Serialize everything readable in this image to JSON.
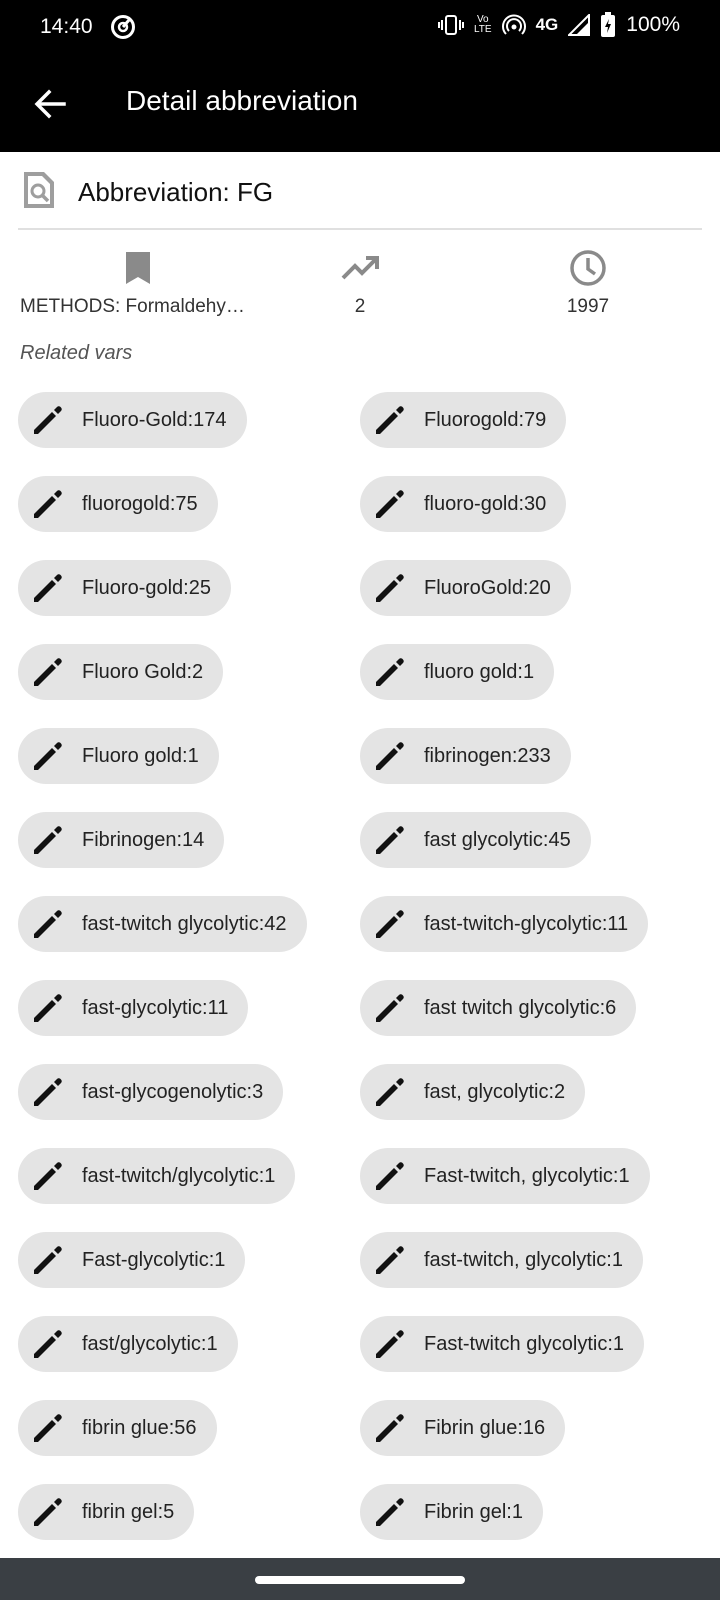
{
  "status_bar": {
    "time": "14:40",
    "volte_top": "Vo",
    "volte_bottom": "LTE",
    "network": "4G",
    "battery": "100%"
  },
  "app_bar": {
    "title": "Detail abbreviation"
  },
  "header": {
    "abbreviation": "Abbreviation: FG"
  },
  "stats": {
    "category": "METHODS: Formaldehyde-...",
    "count": "2",
    "year": "1997"
  },
  "related_label": "Related vars",
  "chips": [
    "Fluoro-Gold:174",
    "Fluorogold:79",
    "fluorogold:75",
    "fluoro-gold:30",
    "Fluoro-gold:25",
    "FluoroGold:20",
    "Fluoro Gold:2",
    "fluoro gold:1",
    "Fluoro gold:1",
    "fibrinogen:233",
    "Fibrinogen:14",
    "fast glycolytic:45",
    "fast-twitch glycolytic:42",
    "fast-twitch-glycolytic:11",
    "fast-glycolytic:11",
    "fast twitch glycolytic:6",
    "fast-glycogenolytic:3",
    "fast, glycolytic:2",
    "fast-twitch/glycolytic:1",
    "Fast-twitch, glycolytic:1",
    "Fast-glycolytic:1",
    "fast-twitch, glycolytic:1",
    "fast/glycolytic:1",
    "Fast-twitch glycolytic:1",
    "fibrin glue:56",
    "Fibrin glue:16",
    "fibrin gel:5",
    "Fibrin gel:1"
  ]
}
